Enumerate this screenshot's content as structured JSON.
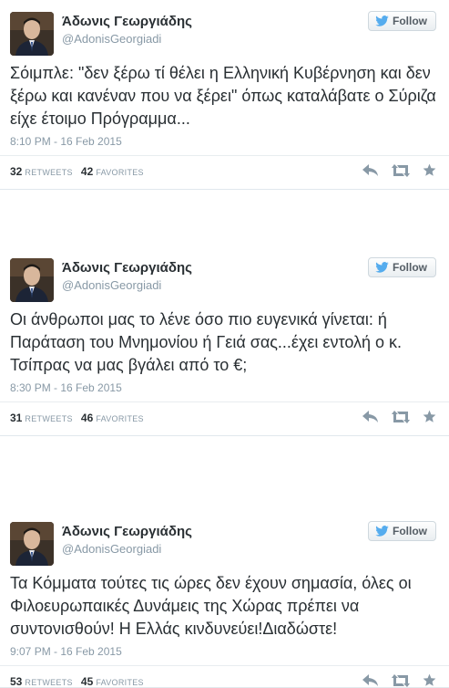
{
  "tweets": [
    {
      "name": "Άδωνις Γεωργιάδης",
      "handle": "@AdonisGeorgiadi",
      "follow_label": "Follow",
      "text": "Σόιμπλε: \"δεν ξέρω τί θέλει η Ελληνική Κυβέρνηση και δεν ξέρω και κανέναν που να ξέρει\" όπως καταλάβατε ο Σύριζα είχε έτοιμο Πρόγραμμα...",
      "time": "8:10 PM - 16 Feb 2015",
      "retweets": "32",
      "retweets_label": "RETWEETS",
      "favorites": "42",
      "favorites_label": "FAVORITES"
    },
    {
      "name": "Άδωνις Γεωργιάδης",
      "handle": "@AdonisGeorgiadi",
      "follow_label": "Follow",
      "text": "Οι άνθρωποι μας το λένε όσο πιο ευγενικά γίνεται: ή Παράταση του Μνημονίου ή Γειά σας...έχει εντολή ο κ. Τσίπρας να μας βγάλει από το €;",
      "time": "8:30 PM - 16 Feb 2015",
      "retweets": "31",
      "retweets_label": "RETWEETS",
      "favorites": "46",
      "favorites_label": "FAVORITES"
    },
    {
      "name": "Άδωνις Γεωργιάδης",
      "handle": "@AdonisGeorgiadi",
      "follow_label": "Follow",
      "text": "Τα Κόμματα τούτες τις ώρες δεν έχουν σημασία, όλες οι Φιλοευρωπαικές Δυνάμεις της Χώρας πρέπει να συντονισθούν! Η Ελλάς κινδυνεύει!Διαδώστε!",
      "time": "9:07 PM - 16 Feb 2015",
      "retweets": "53",
      "retweets_label": "RETWEETS",
      "favorites": "45",
      "favorites_label": "FAVORITES"
    }
  ],
  "icons": {
    "follow": "twitter-bird-icon",
    "reply": "reply-icon",
    "retweet": "retweet-icon",
    "favorite": "star-icon"
  },
  "colors": {
    "twitter_blue": "#55acee",
    "muted": "#8899a6",
    "text": "#292f33",
    "action_icon": "#8899a6"
  }
}
